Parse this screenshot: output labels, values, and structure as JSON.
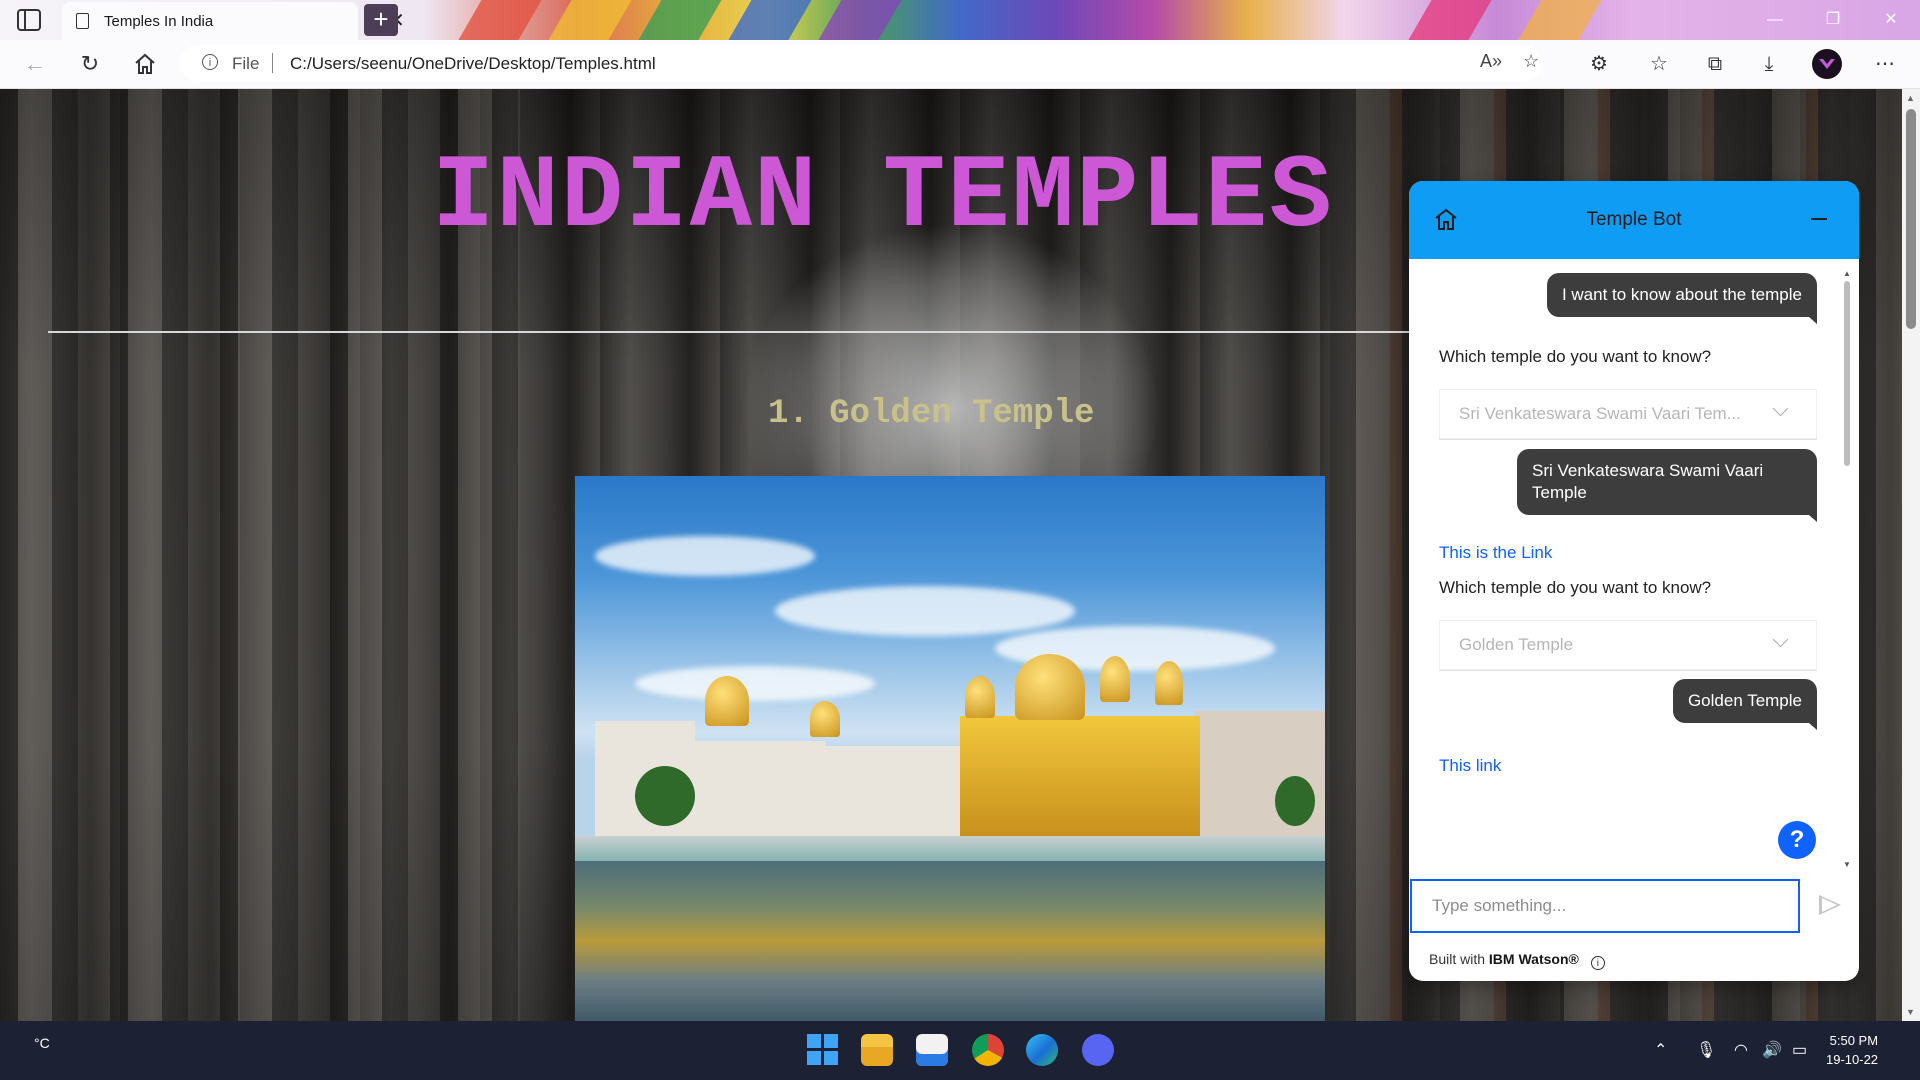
{
  "browser": {
    "tab_title": "Temples In India",
    "tab_close": "✕",
    "new_tab": "+",
    "url_scheme": "File",
    "url": "C:/Users/seenu/OneDrive/Desktop/Temples.html"
  },
  "page": {
    "heading": "INDIAN TEMPLES",
    "subheading": "1. Golden Temple"
  },
  "chat": {
    "title": "Temple Bot",
    "messages": [
      {
        "type": "user",
        "text": "I want to know about the temple"
      },
      {
        "type": "bot",
        "text": "Which temple do you want to know?"
      },
      {
        "type": "dropdown",
        "value": "Sri Venkateswara Swami Vaari Tem..."
      },
      {
        "type": "user",
        "text": "Sri Venkateswara Swami Vaari Temple"
      },
      {
        "type": "link",
        "text": "This is the Link"
      },
      {
        "type": "bot",
        "text": "Which temple do you want to know?"
      },
      {
        "type": "dropdown",
        "value": "Golden Temple"
      },
      {
        "type": "user",
        "text": "Golden Temple"
      },
      {
        "type": "link",
        "text": "This link"
      }
    ],
    "input_placeholder": "Type something...",
    "help_label": "?",
    "footer_prefix": "Built with ",
    "footer_brand": "IBM Watson®"
  },
  "taskbar": {
    "weather": "°C",
    "time": "5:50 PM",
    "date": "19-10-22"
  },
  "colors": {
    "heading": "#cd58d6",
    "subheading": "#c9c18a",
    "chat_header": "#0f9cf5",
    "user_bubble": "#3d3d3d",
    "link": "#0f62fe"
  }
}
